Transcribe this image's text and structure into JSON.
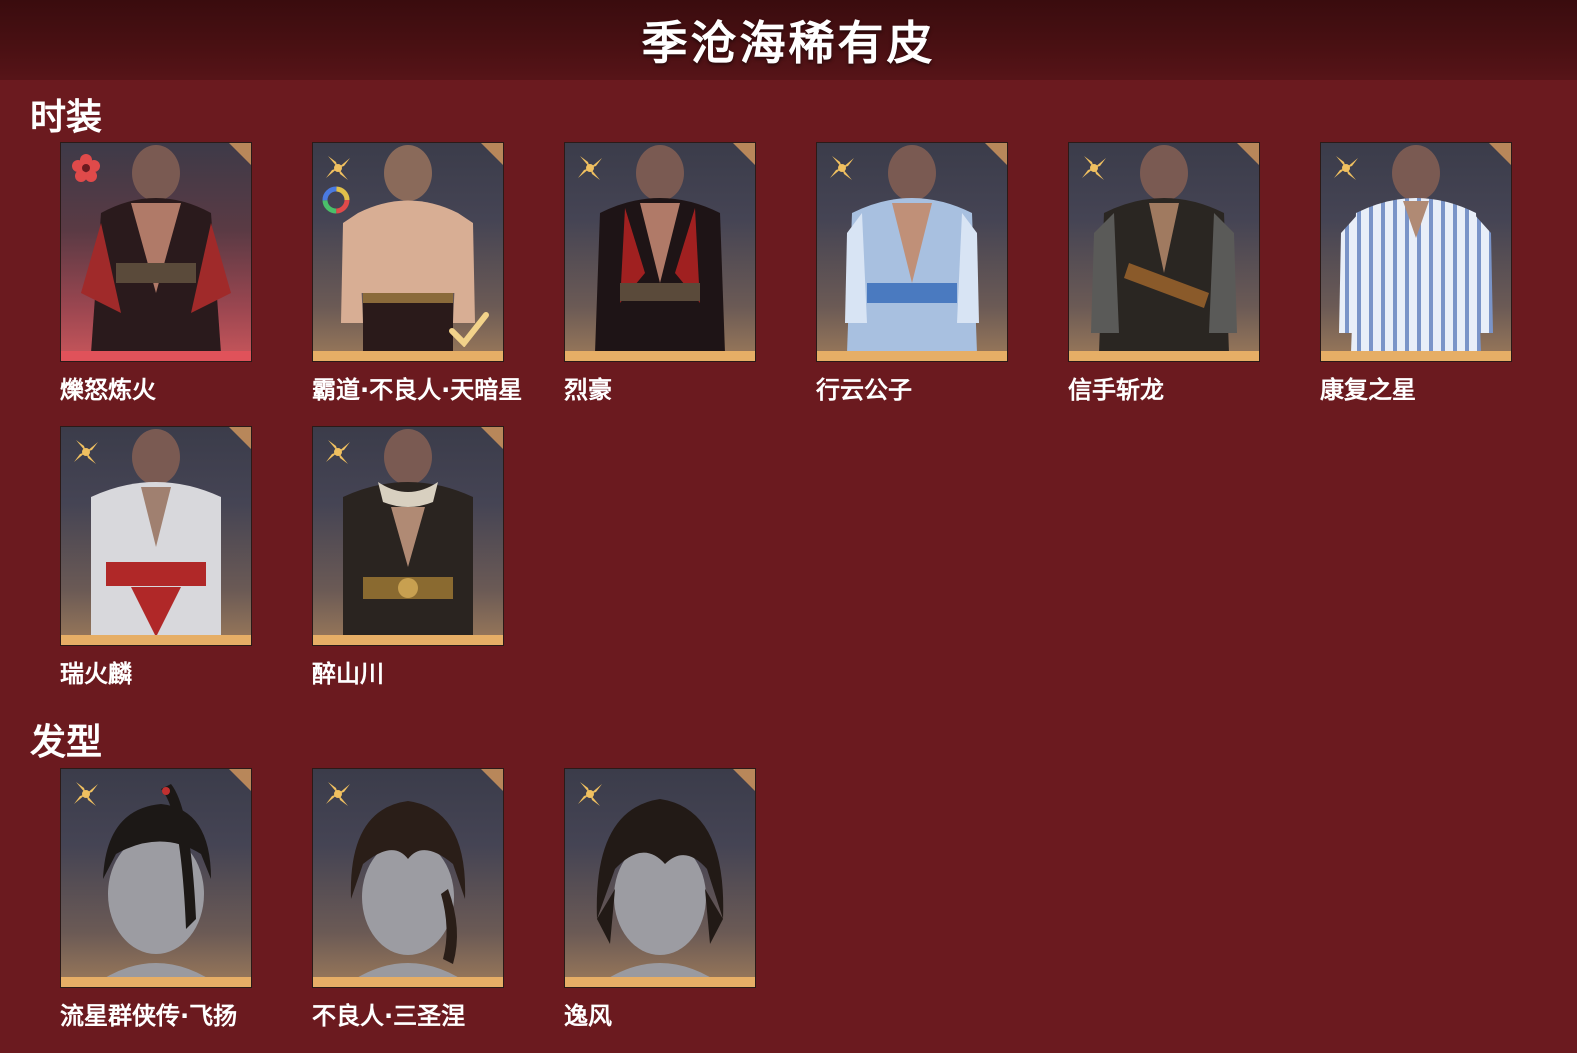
{
  "header": {
    "title": "季沧海稀有皮"
  },
  "sections": {
    "outfits": {
      "title": "时装",
      "items": [
        {
          "label": "爍怒炼火",
          "rarity_icon": "red-flower-icon"
        },
        {
          "label": "霸道·不良人·天暗星",
          "rarity_icon": "gold-flower-icon",
          "equipped": true,
          "dye_icon": "color-wheel-icon"
        },
        {
          "label": "烈豪",
          "rarity_icon": "gold-flower-icon"
        },
        {
          "label": "行云公子",
          "rarity_icon": "gold-flower-icon"
        },
        {
          "label": "信手斩龙",
          "rarity_icon": "gold-flower-icon"
        },
        {
          "label": "康复之星",
          "rarity_icon": "gold-flower-icon"
        },
        {
          "label": "瑞火麟",
          "rarity_icon": "gold-flower-icon"
        },
        {
          "label": "醉山川",
          "rarity_icon": "gold-flower-icon"
        }
      ]
    },
    "hairstyles": {
      "title": "发型",
      "items": [
        {
          "label": "流星群侠传·飞扬",
          "rarity_icon": "gold-flower-icon"
        },
        {
          "label": "不良人·三圣涅",
          "rarity_icon": "gold-flower-icon"
        },
        {
          "label": "逸风",
          "rarity_icon": "gold-flower-icon"
        }
      ]
    }
  },
  "colors": {
    "background": "#6b1a1f",
    "header": "#3a0c0e",
    "gold_bar": "#e6ae66",
    "red_bar": "#e0525a"
  }
}
